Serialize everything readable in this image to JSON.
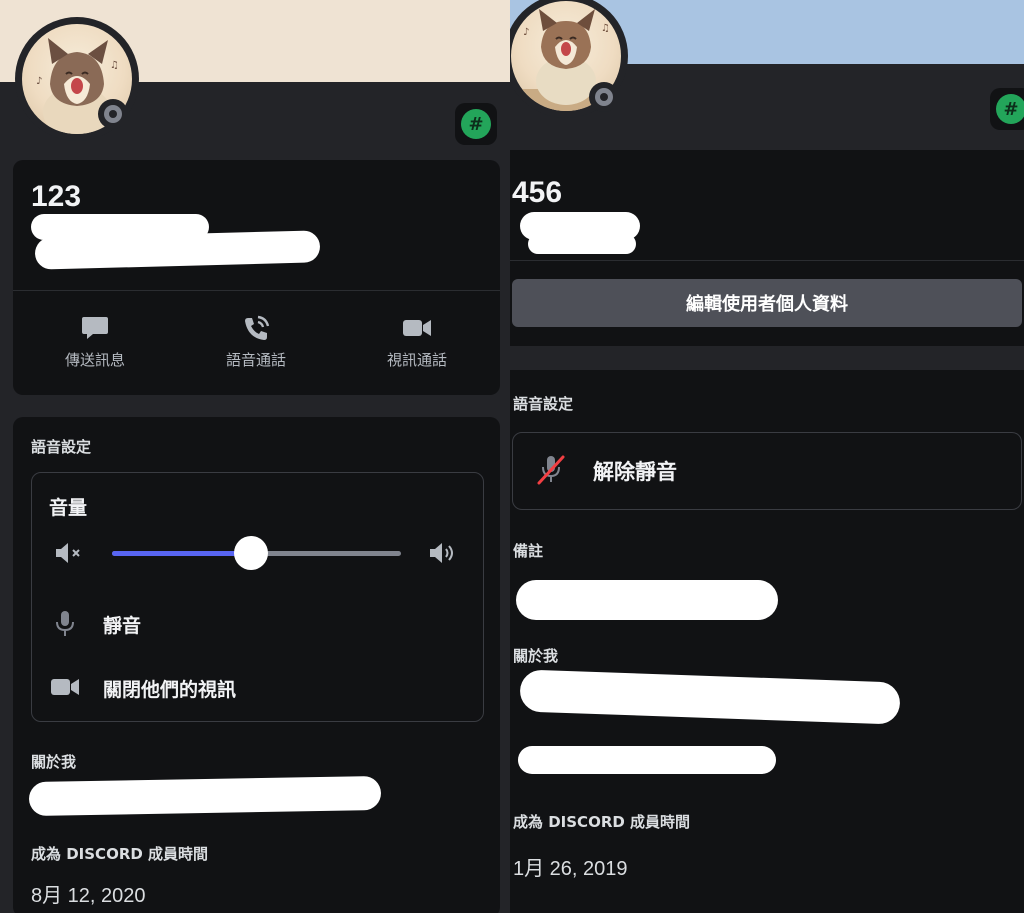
{
  "left_profile": {
    "username": "123",
    "actions": [
      {
        "label": "傳送訊息",
        "icon": "message-icon"
      },
      {
        "label": "語音通話",
        "icon": "phone-call-icon"
      },
      {
        "label": "視訊通話",
        "icon": "video-camera-icon"
      }
    ],
    "voice_settings": {
      "title": "語音設定",
      "volume_label": "音量",
      "volume_level": 0.48,
      "mute_label": "靜音",
      "disable_video_label": "關閉他們的視訊"
    },
    "about_me_title": "關於我",
    "member_since_title": "成為 DISCORD 成員時間",
    "member_since_value": "8月 12, 2020",
    "badge_symbol": "#"
  },
  "right_profile": {
    "username": "456",
    "edit_button_label": "編輯使用者個人資料",
    "voice_settings_title": "語音設定",
    "unmute_label": "解除靜音",
    "note_title": "備註",
    "about_me_title": "關於我",
    "member_since_title": "成為 DISCORD 成員時間",
    "member_since_value": "1月 26, 2019",
    "badge_symbol": "#"
  },
  "colors": {
    "accent_blue": "#5865f2",
    "status_offline": "#80848e",
    "badge_green": "#23a55a",
    "mute_red": "#f23f43"
  }
}
